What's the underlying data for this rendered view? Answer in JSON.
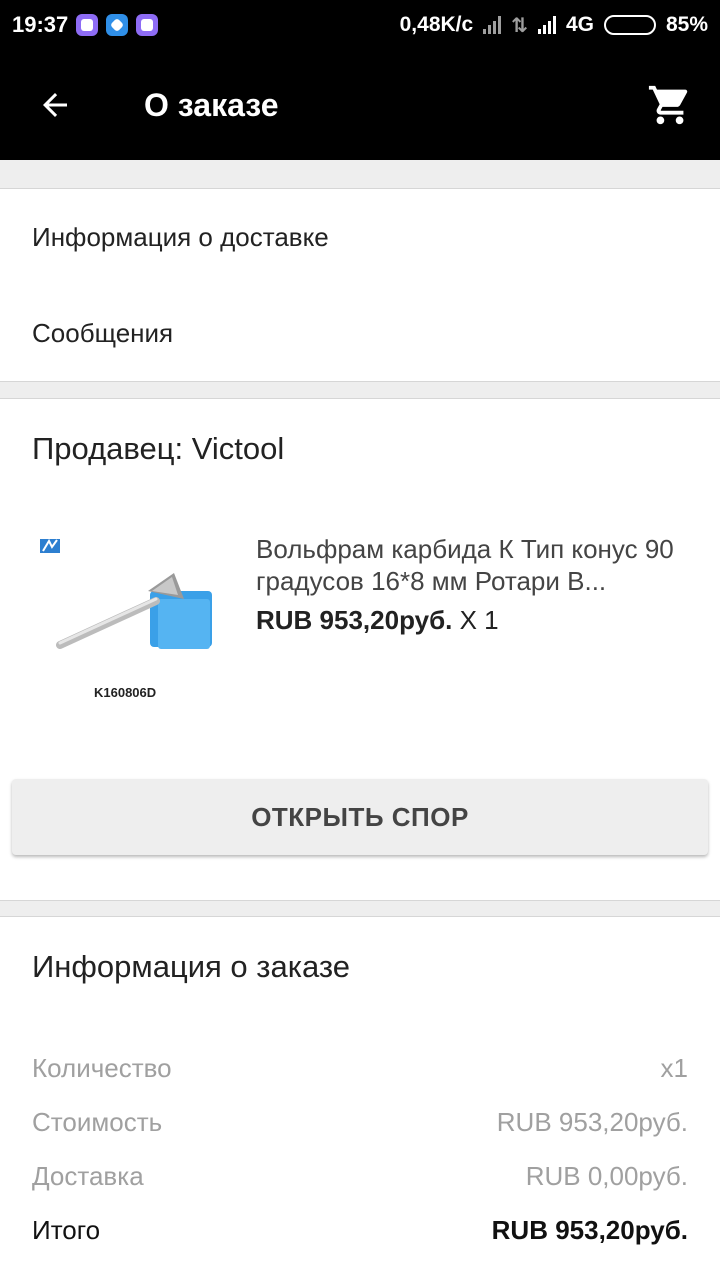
{
  "status_bar": {
    "time": "19:37",
    "speed": "0,48K/c",
    "network": "4G",
    "battery": "85%",
    "battery_level": 0.85,
    "icons": [
      "app-purple-icon",
      "app-blue-icon",
      "app-purple-icon"
    ]
  },
  "toolbar": {
    "title": "О заказе",
    "back_icon": "arrow-back-icon",
    "cart_icon": "cart-icon"
  },
  "links": {
    "delivery": "Информация о доставке",
    "messages": "Сообщения"
  },
  "seller": {
    "title": "Продавец: Victool",
    "product": {
      "name": "Вольфрам карбида К Тип конус 90 градусов 16*8 мм Ротари В...",
      "price": "RUB 953,20руб.",
      "qty": " X 1",
      "image_label": "K160806D"
    },
    "dispute_button": "ОТКРЫТЬ СПОР"
  },
  "order_info": {
    "title": "Информация о заказе",
    "rows": [
      {
        "label": "Количество",
        "value": "x1"
      },
      {
        "label": "Стоимость",
        "value": "RUB 953,20руб."
      },
      {
        "label": "Доставка",
        "value": "RUB 0,00руб."
      },
      {
        "label": "Итого",
        "value": "RUB 953,20руб."
      }
    ]
  },
  "colors": {
    "bar": "#000000",
    "card": "#ffffff",
    "background": "#eeeeee",
    "muted_text": "#a0a0a0",
    "product_box": "#3aa0e8"
  }
}
